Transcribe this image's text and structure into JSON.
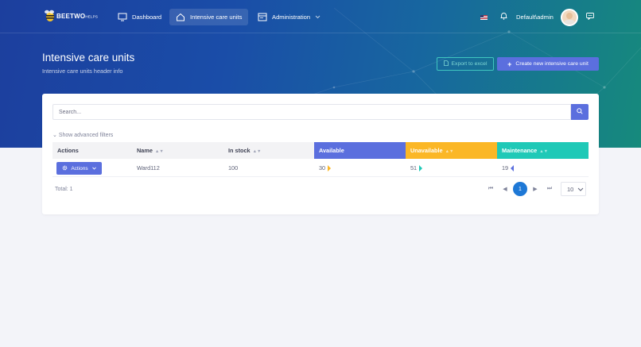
{
  "app": {
    "logo_text": "BEETWO",
    "logo_suffix": "HELPS"
  },
  "nav": {
    "dashboard": "Dashboard",
    "icu": "Intensive care units",
    "administration": "Administration"
  },
  "user": {
    "name": "Default\\admin"
  },
  "page": {
    "title": "Intensive care units",
    "subtitle": "Intensive care units header info",
    "export_label": "Export to excel",
    "create_label": "Create new intensive care unit"
  },
  "search": {
    "placeholder": "Search..."
  },
  "filters": {
    "advanced_label": "Show advanced filters"
  },
  "table": {
    "headers": {
      "actions": "Actions",
      "name": "Name",
      "in_stock": "In stock",
      "available": "Available",
      "unavailable": "Unavailable",
      "maintenance": "Maintenance"
    },
    "rows": [
      {
        "actions_label": "Actions",
        "name": "Ward112",
        "in_stock": "100",
        "available": "30",
        "unavailable": "51",
        "maintenance": "19"
      }
    ],
    "total": "Total: 1"
  },
  "pagination": {
    "current": "1",
    "page_size": "10"
  },
  "colors": {
    "primary": "#5b6fde",
    "available": "#5b6fde",
    "unavailable": "#fbb726",
    "maintenance": "#1fc9b7",
    "page_active": "#1e78d6"
  }
}
